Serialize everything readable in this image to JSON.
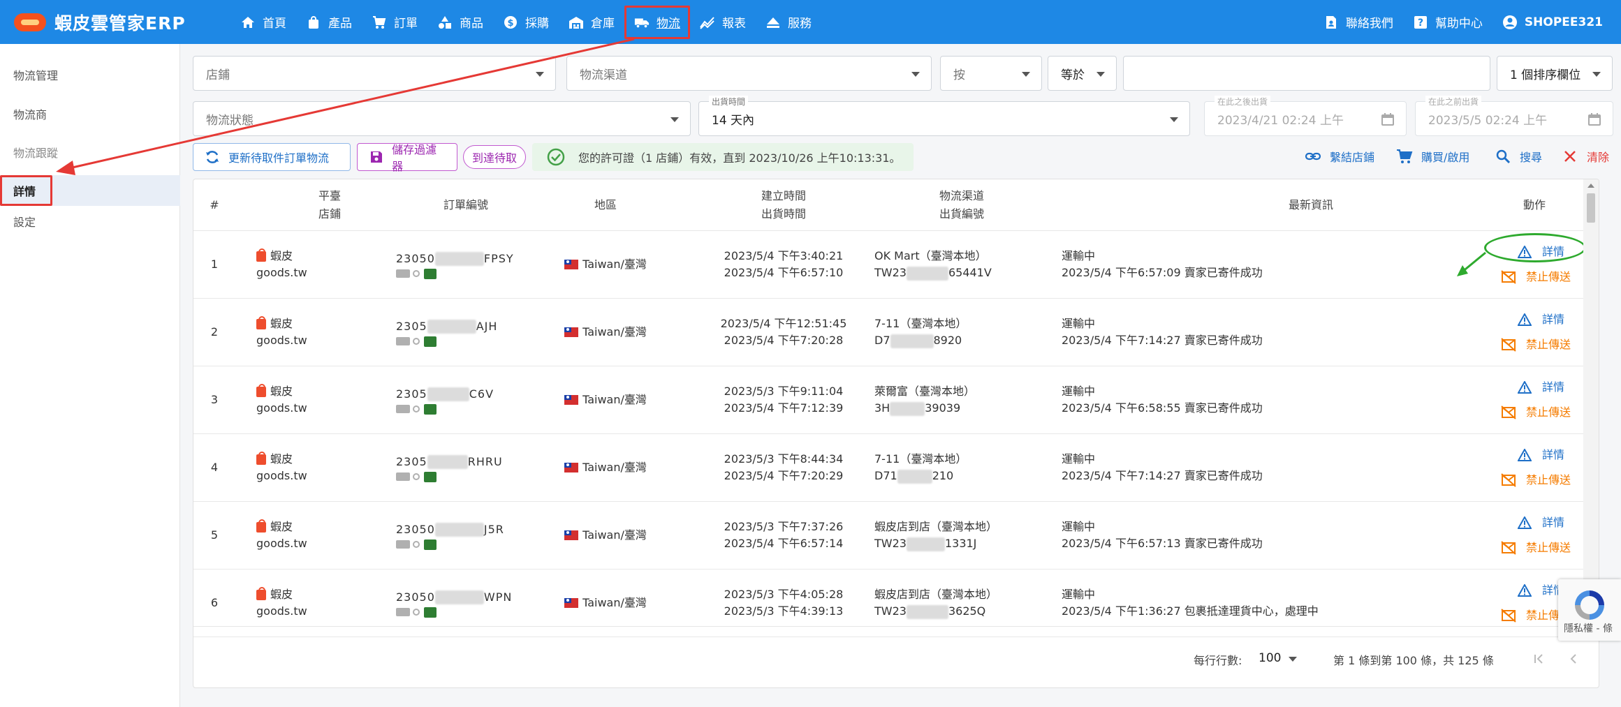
{
  "app": {
    "title": "蝦皮雲管家ERP"
  },
  "nav": {
    "items": [
      {
        "label": "首頁",
        "icon": "home-icon"
      },
      {
        "label": "產品",
        "icon": "bag-icon"
      },
      {
        "label": "訂單",
        "icon": "cart-icon"
      },
      {
        "label": "商品",
        "icon": "shapes-icon"
      },
      {
        "label": "採購",
        "icon": "dollar-icon"
      },
      {
        "label": "倉庫",
        "icon": "warehouse-icon"
      },
      {
        "label": "物流",
        "icon": "truck-icon",
        "active": true
      },
      {
        "label": "報表",
        "icon": "chart-icon"
      },
      {
        "label": "服務",
        "icon": "eject-icon"
      }
    ],
    "right": {
      "contact": "聯絡我們",
      "help": "幫助中心",
      "user": "SHOPEE321"
    }
  },
  "sidebar": {
    "items": [
      {
        "label": "物流管理"
      },
      {
        "label": "物流商"
      },
      {
        "label": "物流跟蹤"
      },
      {
        "label": "詳情",
        "selected": true
      },
      {
        "label": "設定"
      }
    ]
  },
  "filters": {
    "store_placeholder": "店鋪",
    "channel_placeholder": "物流渠道",
    "by": "按",
    "equals": "等於",
    "search_value": "",
    "sort": "1 個排序欄位",
    "status_placeholder": "物流狀態",
    "ship_time_label": "出貨時間",
    "ship_time_value": "14 天內",
    "after_label": "在此之後出貨",
    "after_value": "2023/4/21 02:24 上午",
    "before_label": "在此之前出貨",
    "before_value": "2023/5/5 02:24 上午"
  },
  "toolbar": {
    "refresh": "更新待取件訂單物流",
    "save_filter": "儲存過濾器",
    "arrival_chip": "到達待取",
    "license": "您的許可證（1 店鋪）有效，直到 2023/10/26 上午10:13:31。",
    "link_store": "繫結店鋪",
    "buy": "購買/啟用",
    "search": "搜尋",
    "clear": "清除"
  },
  "table": {
    "headers": {
      "num": "#",
      "platform": "平臺",
      "store": "店鋪",
      "order_no": "訂單編號",
      "region": "地區",
      "created": "建立時間",
      "shipped": "出貨時間",
      "channel": "物流渠道",
      "ship_no": "出貨編號",
      "latest": "最新資訊",
      "action": "動作"
    },
    "rows": [
      {
        "num": "1",
        "platform": "蝦皮",
        "store": "goods.tw",
        "order_prefix": "23050",
        "order_suffix": "FPSY",
        "region": "Taiwan/臺灣",
        "created": "2023/5/4 下午3:40:21",
        "shipped": "2023/5/4 下午6:57:10",
        "channel": "OK Mart（臺灣本地）",
        "ship_prefix": "TW23",
        "ship_suffix": "65441V",
        "status": "運輸中",
        "latest": "2023/5/4 下午6:57:09 賣家已寄件成功",
        "detail": "詳情",
        "stop": "禁止傳送"
      },
      {
        "num": "2",
        "platform": "蝦皮",
        "store": "goods.tw",
        "order_prefix": "2305",
        "order_suffix": "AJH",
        "region": "Taiwan/臺灣",
        "created": "2023/5/4 下午12:51:45",
        "shipped": "2023/5/4 下午7:20:28",
        "channel": "7-11（臺灣本地）",
        "ship_prefix": "D7",
        "ship_suffix": "8920",
        "status": "運輸中",
        "latest": "2023/5/4 下午7:14:27 賣家已寄件成功",
        "detail": "詳情",
        "stop": "禁止傳送"
      },
      {
        "num": "3",
        "platform": "蝦皮",
        "store": "goods.tw",
        "order_prefix": "2305",
        "order_suffix": "C6V",
        "region": "Taiwan/臺灣",
        "created": "2023/5/3 下午9:11:04",
        "shipped": "2023/5/4 下午7:12:39",
        "channel": "萊爾富（臺灣本地）",
        "ship_prefix": "3H",
        "ship_suffix": "39039",
        "status": "運輸中",
        "latest": "2023/5/4 下午6:58:55 賣家已寄件成功",
        "detail": "詳情",
        "stop": "禁止傳送"
      },
      {
        "num": "4",
        "platform": "蝦皮",
        "store": "goods.tw",
        "order_prefix": "2305",
        "order_suffix": "RHRU",
        "region": "Taiwan/臺灣",
        "created": "2023/5/3 下午8:44:34",
        "shipped": "2023/5/4 下午7:20:29",
        "channel": "7-11（臺灣本地）",
        "ship_prefix": "D71",
        "ship_suffix": "210",
        "status": "運輸中",
        "latest": "2023/5/4 下午7:14:27 賣家已寄件成功",
        "detail": "詳情",
        "stop": "禁止傳送"
      },
      {
        "num": "5",
        "platform": "蝦皮",
        "store": "goods.tw",
        "order_prefix": "23050",
        "order_suffix": "J5R",
        "region": "Taiwan/臺灣",
        "created": "2023/5/3 下午7:37:26",
        "shipped": "2023/5/4 下午6:57:14",
        "channel": "蝦皮店到店（臺灣本地）",
        "ship_prefix": "TW23",
        "ship_suffix": "1331J",
        "status": "運輸中",
        "latest": "2023/5/4 下午6:57:13 賣家已寄件成功",
        "detail": "詳情",
        "stop": "禁止傳送"
      },
      {
        "num": "6",
        "platform": "蝦皮",
        "store": "goods.tw",
        "order_prefix": "23050",
        "order_suffix": "WPN",
        "region": "Taiwan/臺灣",
        "created": "2023/5/3 下午4:05:28",
        "shipped": "2023/5/3 下午4:39:13",
        "channel": "蝦皮店到店（臺灣本地）",
        "ship_prefix": "TW23",
        "ship_suffix": "3625Q",
        "status": "運輸中",
        "latest": "2023/5/4 下午1:36:27 包裹抵達理貨中心，處理中",
        "detail": "詳情",
        "stop": "禁止傳送"
      }
    ]
  },
  "pagination": {
    "rows_per_page_label": "每行行數:",
    "rows_per_page": "100",
    "range": "第 1 條到第 100 條，共 125 條"
  },
  "recaptcha": {
    "text": "隱私權 - 條"
  },
  "colors": {
    "primary": "#1e88e5",
    "annotation_red": "#e53935",
    "annotation_green": "#2eaa2e",
    "warn": "#f57c00"
  }
}
